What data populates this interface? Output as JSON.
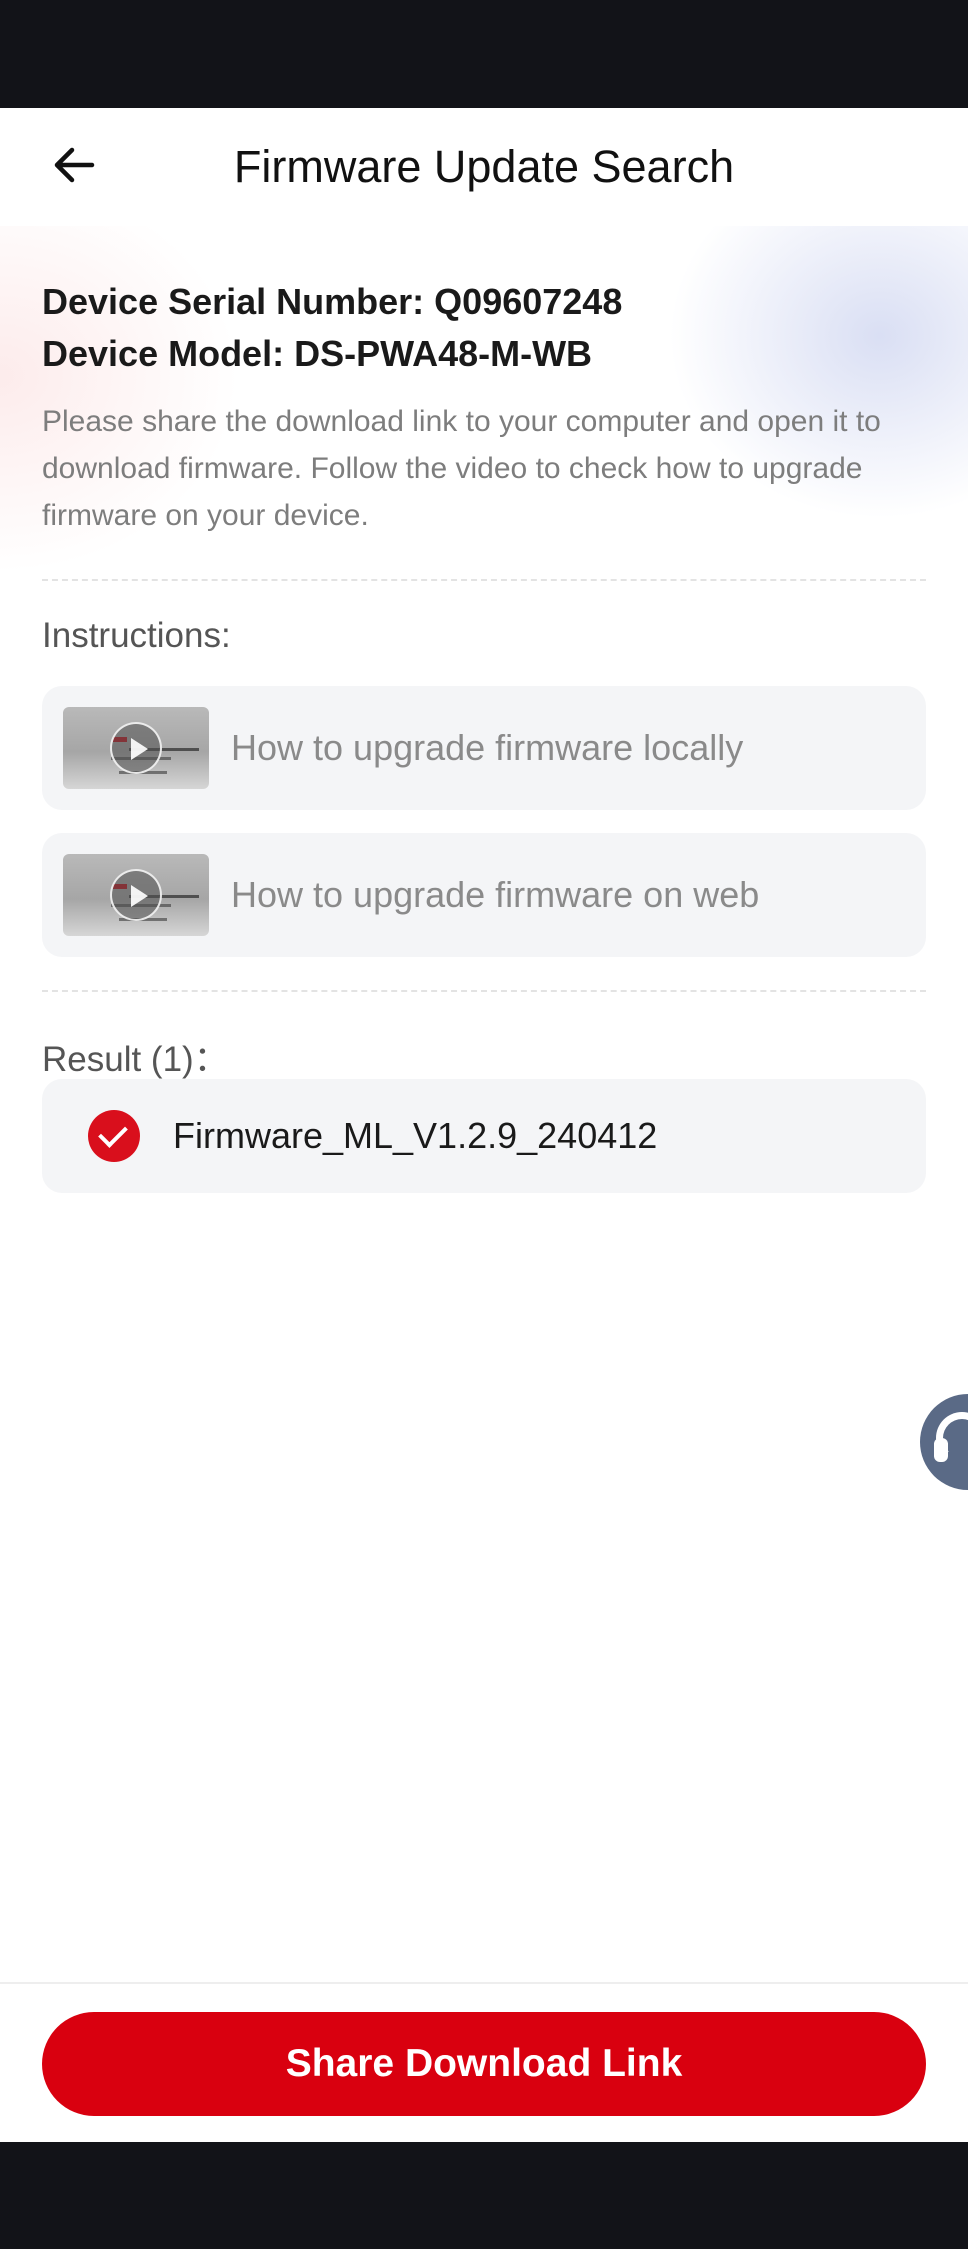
{
  "header": {
    "title": "Firmware Update Search",
    "back_icon": "arrow-left-icon"
  },
  "device": {
    "serial_line": "Device Serial Number: Q09607248",
    "model_line": "Device Model: DS-PWA48-M-WB",
    "description": "Please share the download link to your computer and open it to download firmware. Follow the video to check how to upgrade firmware on your device."
  },
  "instructions": {
    "label": "Instructions:",
    "videos": [
      {
        "label": "How to upgrade firmware locally",
        "icon": "play-icon"
      },
      {
        "label": "How to upgrade firmware on web",
        "icon": "play-icon"
      }
    ]
  },
  "result": {
    "label": "Result (1)：",
    "items": [
      {
        "name": "Firmware_ML_V1.2.9_240412",
        "selected": true,
        "icon": "check-circle-icon"
      }
    ]
  },
  "support": {
    "icon": "headset-icon"
  },
  "footer": {
    "share_label": "Share Download Link"
  },
  "colors": {
    "accent": "#d9000f",
    "status_bar": "#121318",
    "card_bg": "#f4f5f7",
    "support_bg": "#5a6a86"
  }
}
